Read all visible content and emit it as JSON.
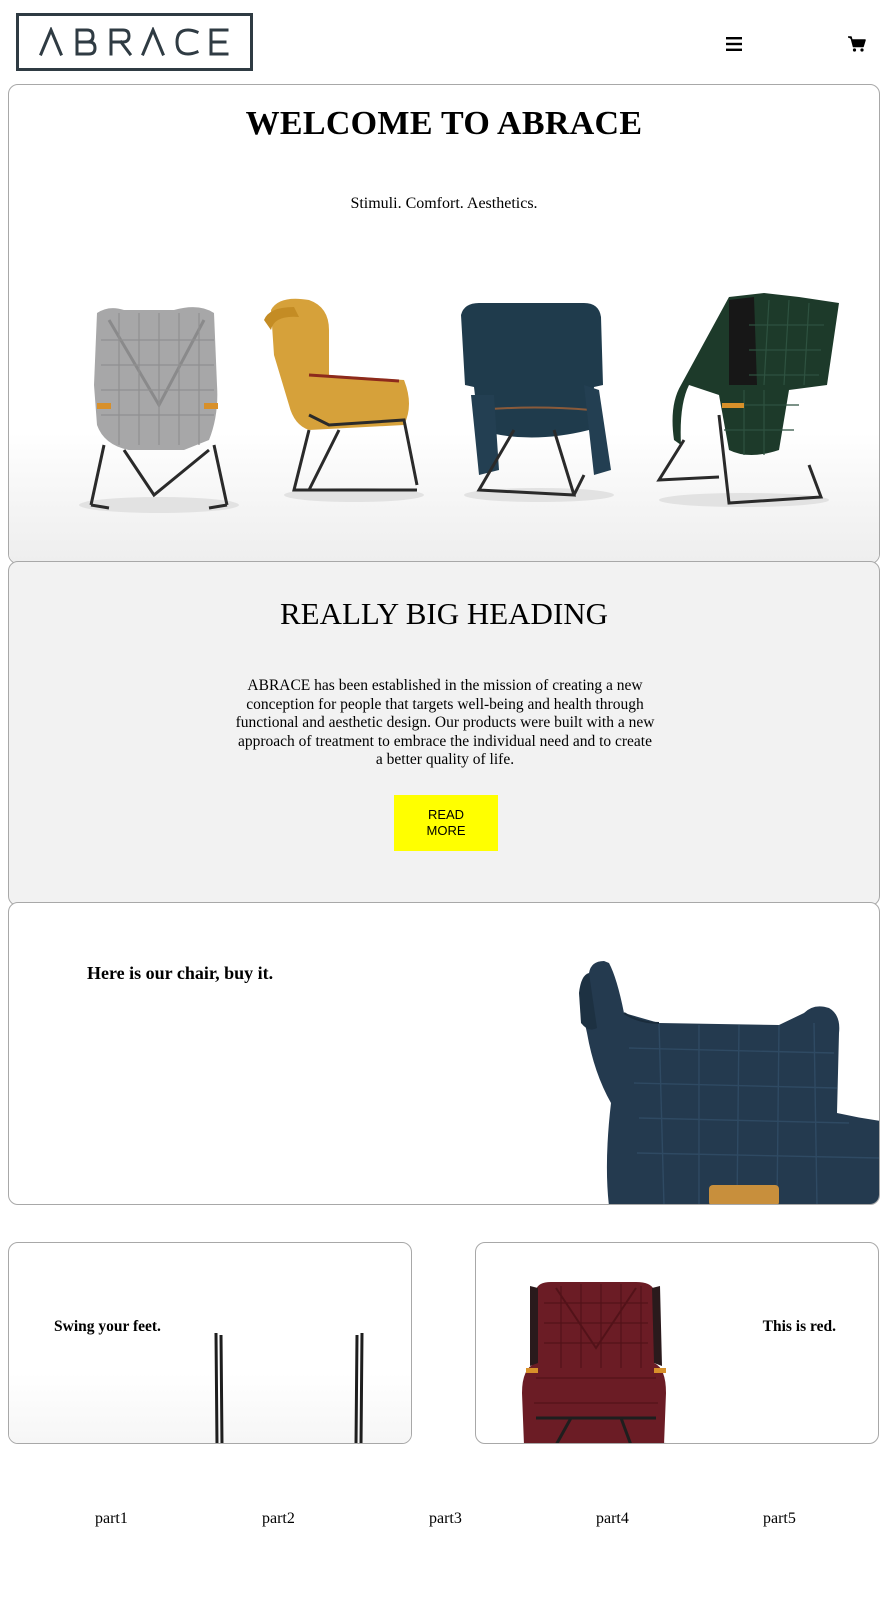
{
  "header": {
    "logo_text": "ABRACE",
    "menu_icon": "hamburger-menu-icon",
    "cart_icon": "shopping-cart-icon",
    "brand_color": "#2f3b43"
  },
  "hero": {
    "title": "WELCOME TO ABRACE",
    "tagline": "Stimuli. Comfort. Aesthetics.",
    "chair_colors": [
      "#9c9c9c",
      "#d9a23a",
      "#1f3b4c",
      "#1f3a2c"
    ]
  },
  "about": {
    "heading": "REALLY BIG HEADING",
    "body": "ABRACE has been established in the mission of creating a new conception for people that targets well-being and health through functional and aesthetic design. Our products were built with a new approach of treatment to embrace the individual need and to create a better quality of life.",
    "button_label": "READ\nMORE",
    "button_color": "#ffff00",
    "background": "#f2f2f2"
  },
  "feature": {
    "heading": "Here is our chair, buy it.",
    "chair_color": "#243a4f"
  },
  "cards": [
    {
      "heading": "Swing your feet."
    },
    {
      "heading": "This is red.",
      "chair_color": "#6b1c25"
    }
  ],
  "footer": {
    "links": [
      "part1",
      "part2",
      "part3",
      "part4",
      "part5"
    ]
  }
}
